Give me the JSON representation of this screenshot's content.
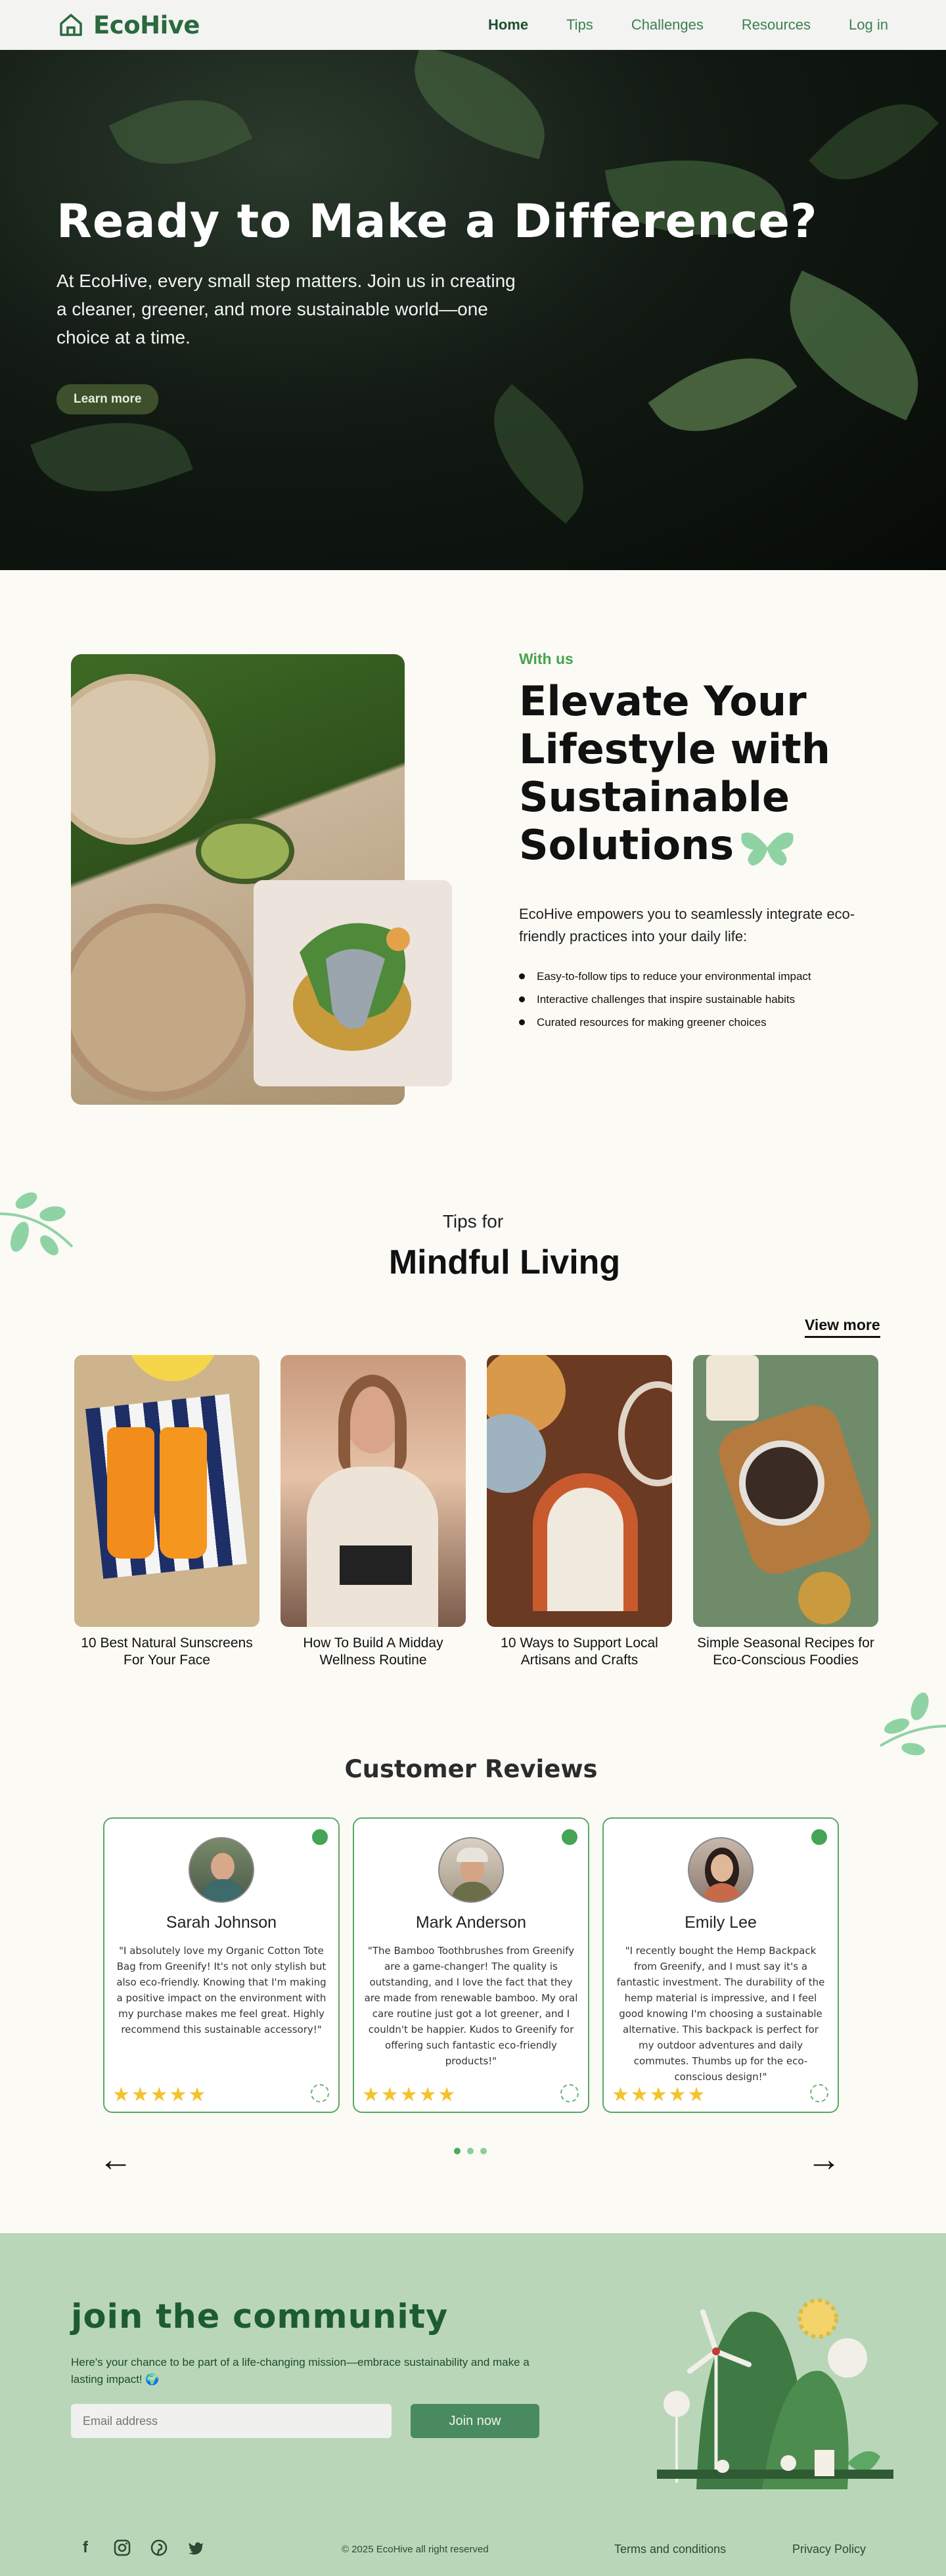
{
  "nav": {
    "brand": "EcoHive",
    "links": [
      "Home",
      "Tips",
      "Challenges",
      "Resources",
      "Log in"
    ]
  },
  "hero": {
    "title": "Ready to Make a Difference?",
    "subtitle": "At EcoHive, every small step matters. Join us in creating a cleaner, greener, and more sustainable world—one choice at a time.",
    "button": "Learn more"
  },
  "elevate": {
    "eyebrow": "With us",
    "title": "Elevate Your Lifestyle with Sustainable Solutions",
    "description": "EcoHive empowers you to seamlessly integrate eco-friendly practices into your daily life:",
    "bullets": [
      "Easy-to-follow tips to reduce your environmental impact",
      "Interactive challenges that inspire sustainable habits",
      "Curated resources for making greener choices"
    ]
  },
  "tips": {
    "pre": "Tips for",
    "title": "Mindful Living",
    "view_more": "View more",
    "items": [
      {
        "caption": "10 Best Natural Sunscreens For Your Face"
      },
      {
        "caption": "How To Build A Midday  Wellness Routine"
      },
      {
        "caption": "10 Ways to Support Local Artisans and Crafts"
      },
      {
        "caption": "Simple Seasonal Recipes for Eco-Conscious  Foodies"
      }
    ]
  },
  "reviews": {
    "title": "Customer Reviews",
    "stars": "★★★★★",
    "items": [
      {
        "name": "Sarah Johnson",
        "text": "\"I absolutely love my Organic Cotton Tote Bag from Greenify! It's not only stylish but also eco-friendly. Knowing that I'm making a positive impact on the environment with my purchase makes me feel great. Highly recommend this sustainable accessory!\""
      },
      {
        "name": "Mark Anderson",
        "text": "\"The Bamboo Toothbrushes from Greenify are a game-changer! The quality is outstanding, and I love the fact that they are made from renewable bamboo. My oral care routine just got a lot greener, and I couldn't be happier. Kudos to Greenify for offering such fantastic eco-friendly products!\""
      },
      {
        "name": "Emily Lee",
        "text": "\"I recently bought the Hemp Backpack from Greenify, and I must say it's a fantastic investment. The durability of the hemp material is impressive, and I feel good knowing I'm choosing a sustainable alternative. This backpack is perfect for my outdoor adventures and daily commutes. Thumbs up for the eco-conscious design!\""
      }
    ],
    "prev": "←",
    "next": "→"
  },
  "community": {
    "title": "join the community",
    "description": "Here's your chance to be part of a life-changing mission—embrace sustainability and make a lasting impact! 🌍",
    "email_placeholder": "Email address",
    "button": "Join now"
  },
  "footer": {
    "copyright": "© 2025 EcoHive all right reserved",
    "terms": "Terms and conditions",
    "privacy": "Privacy Policy",
    "socials": [
      "facebook-icon",
      "instagram-icon",
      "pinterest-icon",
      "twitter-icon"
    ]
  },
  "colors": {
    "brand": "#2a6a3e",
    "accent": "#46a34e",
    "community_bg": "#b9d7b8"
  }
}
